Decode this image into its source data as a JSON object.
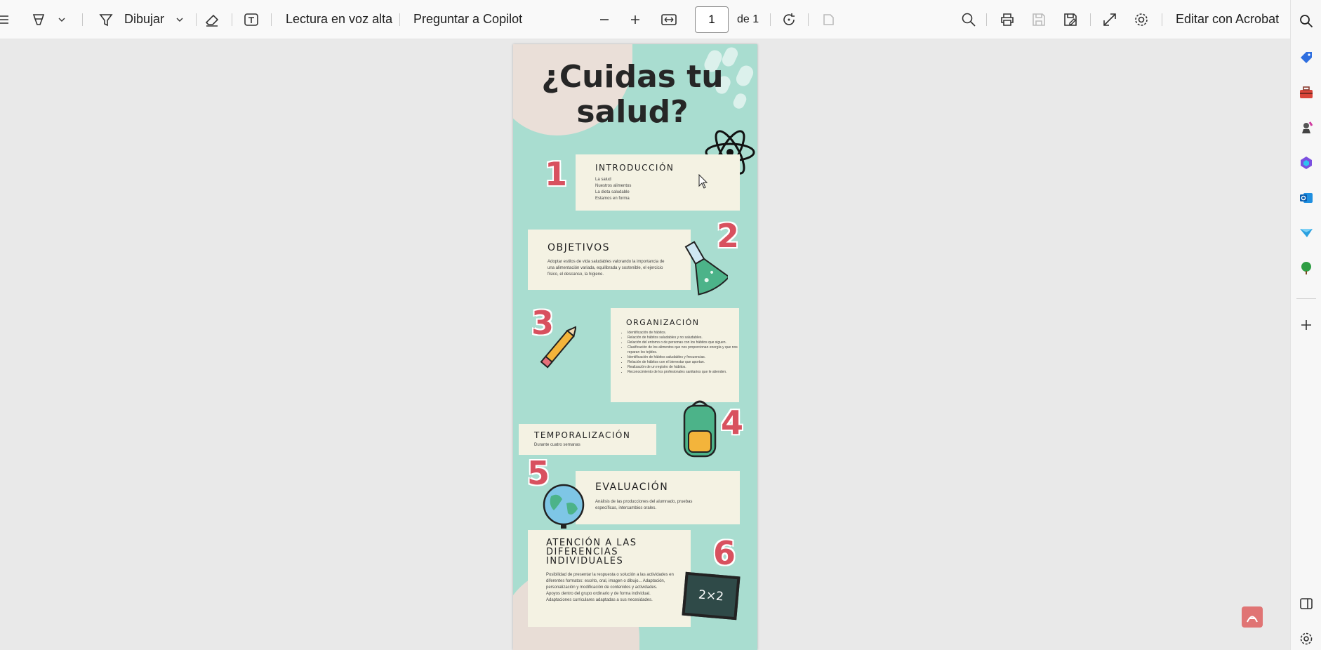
{
  "toolbar": {
    "draw_label": "Dibujar",
    "read_aloud_label": "Lectura en voz alta",
    "ask_copilot_label": "Preguntar a Copilot",
    "page_current": "1",
    "page_total": "de 1",
    "edit_acrobat_label": "Editar con Acrobat"
  },
  "document": {
    "title_line1": "¿Cuidas tu",
    "title_line2": "salud?",
    "sections": [
      {
        "number": "1",
        "heading": "INTRODUCCIÓN",
        "lines": [
          "La salud",
          "Nuestros alimentos",
          "La dieta saludable",
          "Estamos en forma"
        ]
      },
      {
        "number": "2",
        "heading": "OBJETIVOS",
        "text": "Adoptar estilos de vida saludables valorando la importancia de una alimentación variada, equilibrada y sostenible, el ejercicio físico, el descanso, la higiene."
      },
      {
        "number": "3",
        "heading": "ORGANIZACIÓN",
        "bullets": [
          "Identificación de hábitos.",
          "Relación de hábitos saludables y no saludables.",
          "Relación del entorno o de personas con los hábitos que siguen.",
          "Clasificación de los alimentos que nos proporcionan energía y que nos reparan los tejidos.",
          "Identificación de hábitos saludables y frecuencias.",
          "Relación de hábitos con el bienestar que aportan.",
          "Realización de un registro de hábitos.",
          "Reconocimiento de los profesionales sanitarios que le atienden."
        ]
      },
      {
        "number": "4",
        "heading": "TEMPORALIZACIÓN",
        "text": "Durante cuatro semanas"
      },
      {
        "number": "5",
        "heading": "EVALUACIÓN",
        "text": "Análisis de las producciones del alumnado, pruebas específicas, intercambios orales."
      },
      {
        "number": "6",
        "heading_line1": "ATENCIÓN A LAS",
        "heading_line2": "DIFERENCIAS",
        "heading_line3": "INDIVIDUALES",
        "lines": [
          "Posibilidad de presentar la respuesta o solución a las actividades en diferentes formatos: escrito, oral, imagen o dibujo... Adaptación, personalización y modificación de contenidos y actividades.",
          "Apoyos dentro del grupo ordinario y de forma individual.",
          "Adaptaciones curriculares adaptadas a sus necesidades."
        ]
      }
    ],
    "chalkboard_text": "2×2"
  },
  "icons": {
    "colors": {
      "accent": "#d8515f",
      "teal": "#a9ddd0",
      "card": "#f4f2e3"
    }
  }
}
